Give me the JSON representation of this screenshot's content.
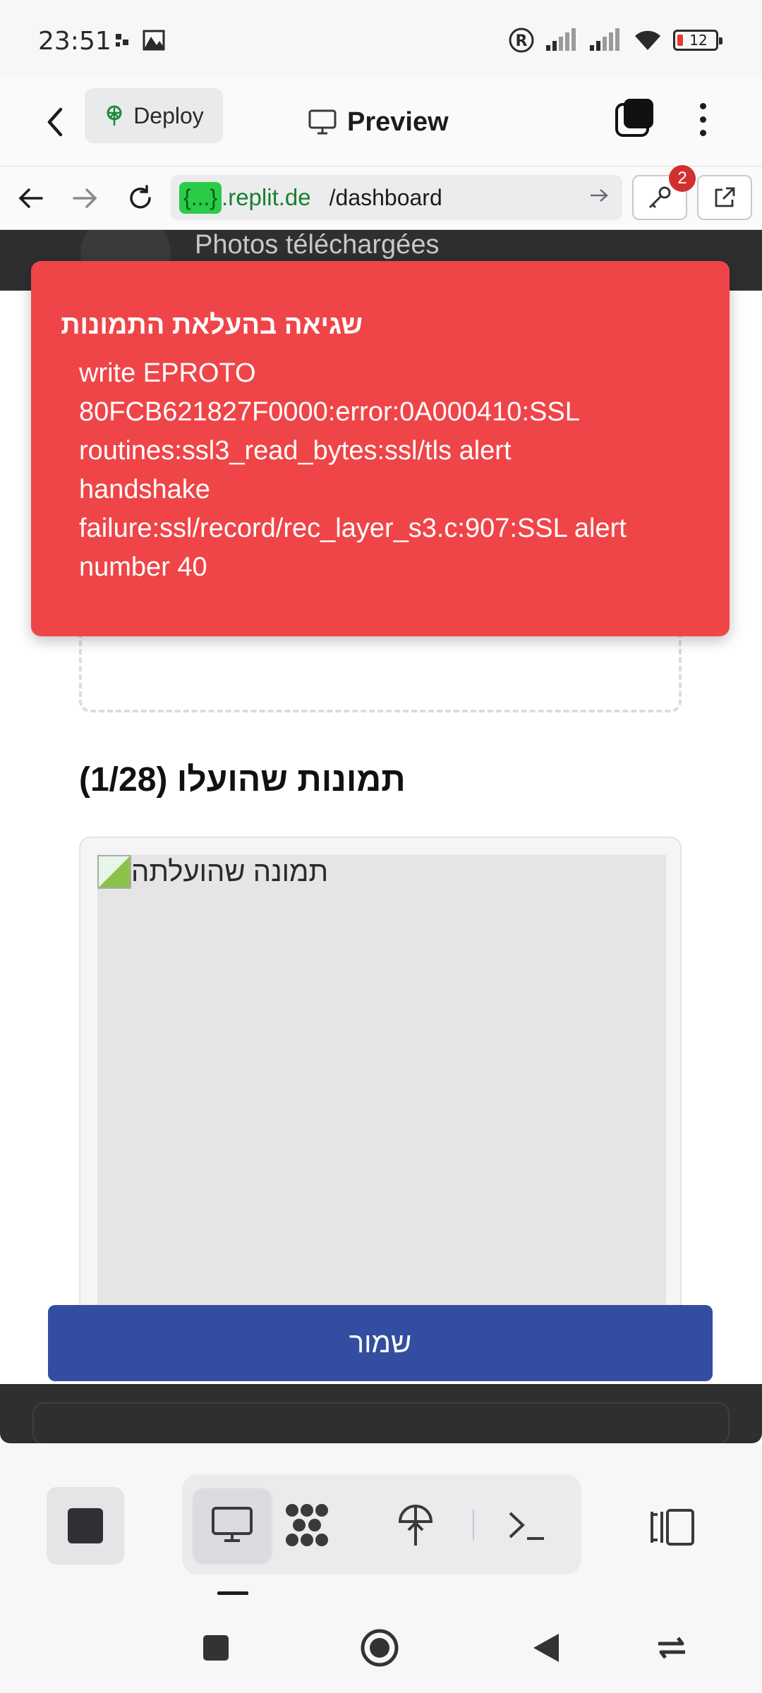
{
  "status_bar": {
    "time": "23:51",
    "battery": "12"
  },
  "app_header": {
    "deploy_label": "Deploy",
    "preview_label": "Preview"
  },
  "url_bar": {
    "host_badge": "{...}",
    "host": ".replit.de",
    "path": "/dashboard",
    "notifications_count": "2"
  },
  "page": {
    "photos_header": "Photos téléchargées",
    "gallery_title": "תמונות שהועלו (1/28)",
    "image_alt": "תמונה שהועלתה",
    "save_label": "שמור"
  },
  "toast": {
    "title": "שגיאה בהעלאת התמונות",
    "lines": [
      "write EPROTO",
      "80FCB621827F0000:error:0A000410:SSL",
      "routines:ssl3_read_bytes:ssl/tls alert",
      "handshake",
      "failure:ssl/record/rec_layer_s3.c:907:SSL alert",
      "number 40"
    ],
    "color": "#ef4548"
  },
  "colors": {
    "save_button": "#334ea0",
    "url_badge": "#2bcb48",
    "dark_band": "#2f2f31"
  }
}
